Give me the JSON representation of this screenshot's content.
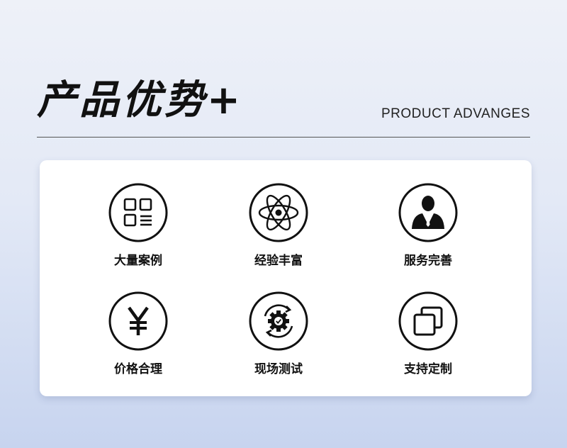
{
  "header": {
    "title": "产品优势+",
    "subtitle": "PRODUCT  ADVANGES"
  },
  "features": [
    {
      "label": "大量案例",
      "icon": "grid-list-icon"
    },
    {
      "label": "经验丰富",
      "icon": "atom-icon"
    },
    {
      "label": "服务完善",
      "icon": "businessman-icon"
    },
    {
      "label": "价格合理",
      "icon": "yen-icon"
    },
    {
      "label": "现场测试",
      "icon": "gear-check-icon"
    },
    {
      "label": "支持定制",
      "icon": "overlapping-squares-icon"
    }
  ],
  "colors": {
    "icon": "#111111",
    "card": "#ffffff",
    "text": "#111111"
  }
}
